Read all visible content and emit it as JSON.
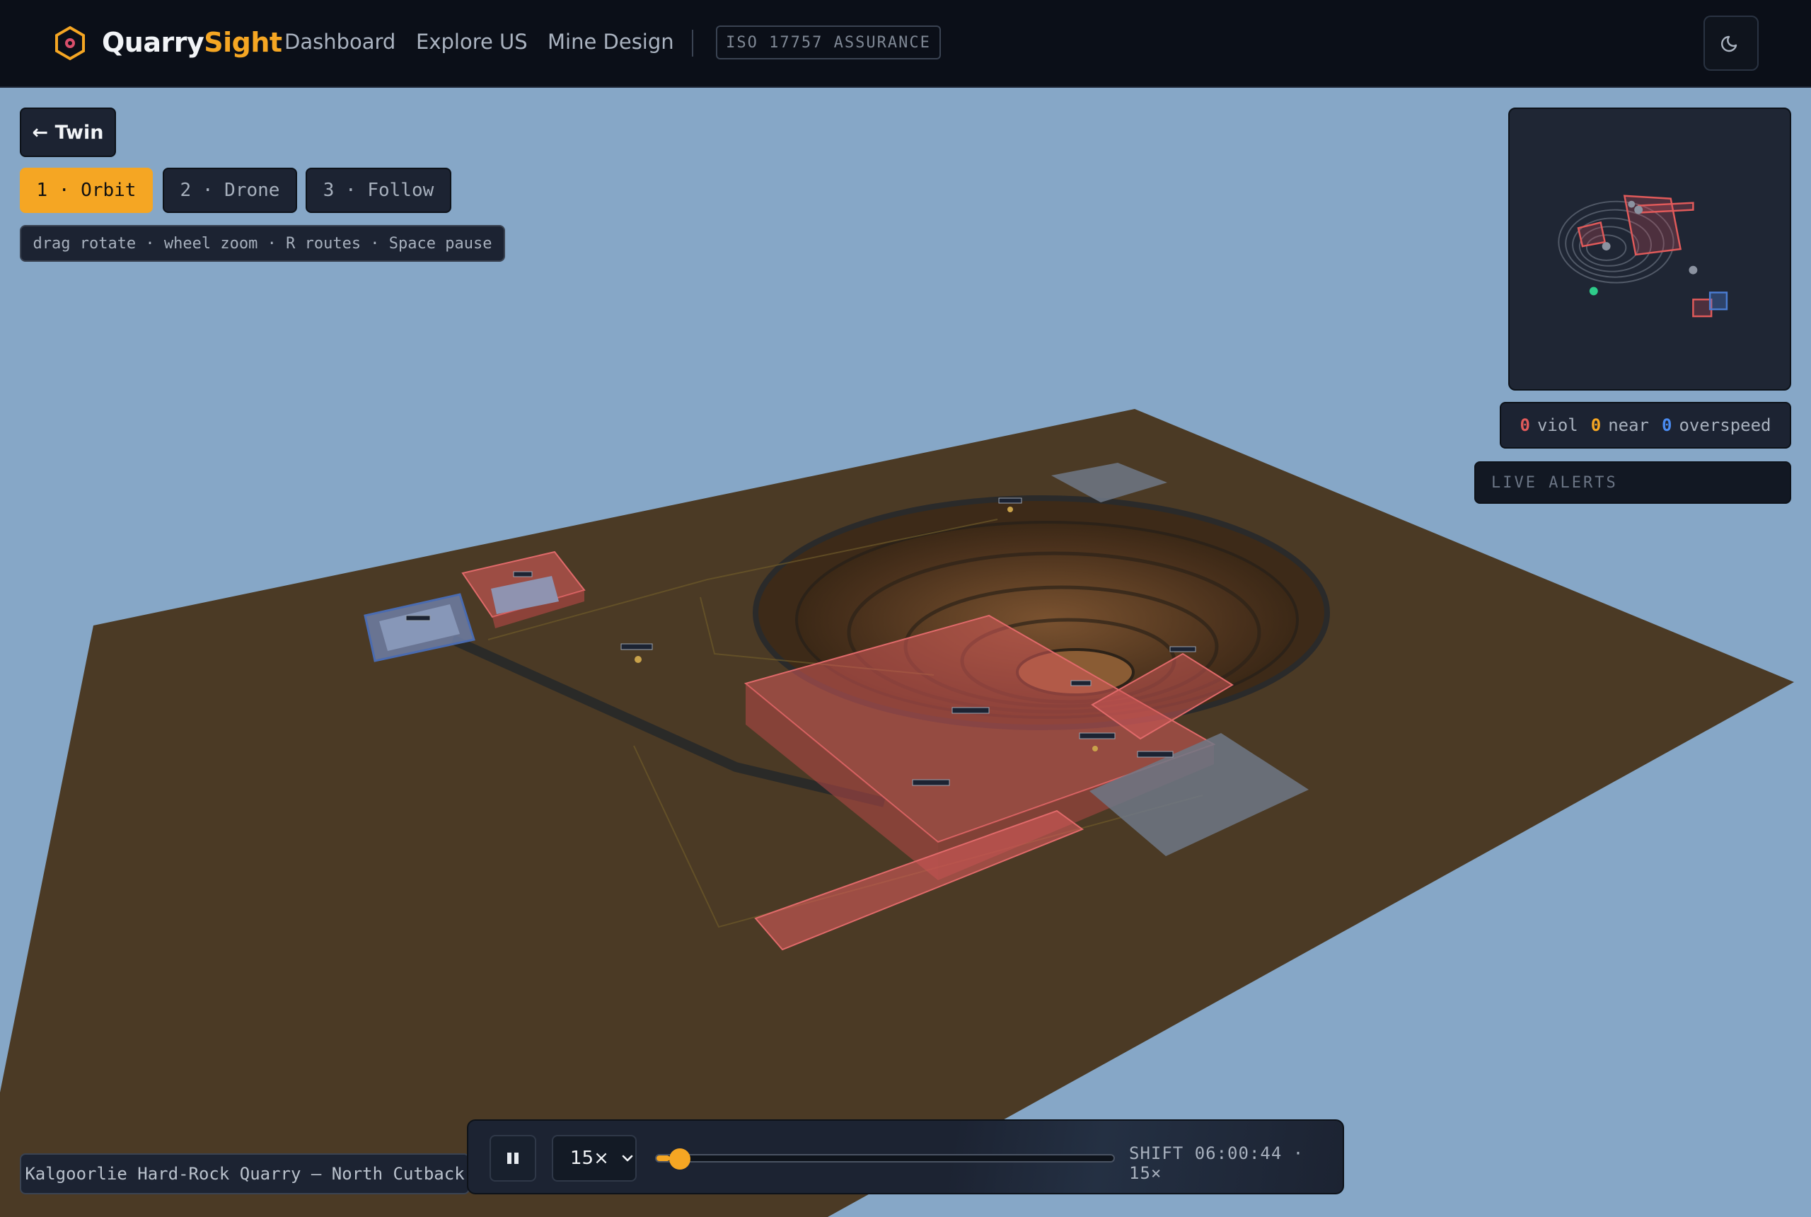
{
  "nav": {
    "brand_main": "Quarry",
    "brand_accent": "Sight",
    "links": [
      "Dashboard",
      "Explore US",
      "Mine Design"
    ],
    "badge": "ISO 17757 ASSURANCE",
    "theme_icon": "moon-icon"
  },
  "controls": {
    "back_label": "← Twin",
    "modes": [
      "1 · Orbit",
      "2 · Drone",
      "3 · Follow"
    ],
    "active_mode": 0,
    "hint": "drag rotate · wheel zoom · R routes · Space pause"
  },
  "alerts": {
    "violations": "0",
    "viol_label": "viol",
    "near": "0",
    "near_label": "near",
    "overspeed": "0",
    "overspeed_label": "overspeed",
    "live_title": "LIVE ALERTS"
  },
  "location": "Kalgoorlie Hard-Rock Quarry — North Cutback",
  "timeline": {
    "speed": "15×",
    "progress": 0.03,
    "status": "SHIFT 06:00:44 · 15×",
    "pause_icon": "pause-icon"
  },
  "colors": {
    "accent": "#f5a623",
    "sky": "#86a7c7",
    "ground": "#4a3a25",
    "danger": "#e05a5a",
    "safe": "#4a7bd0",
    "ok": "#2ecc8a"
  }
}
